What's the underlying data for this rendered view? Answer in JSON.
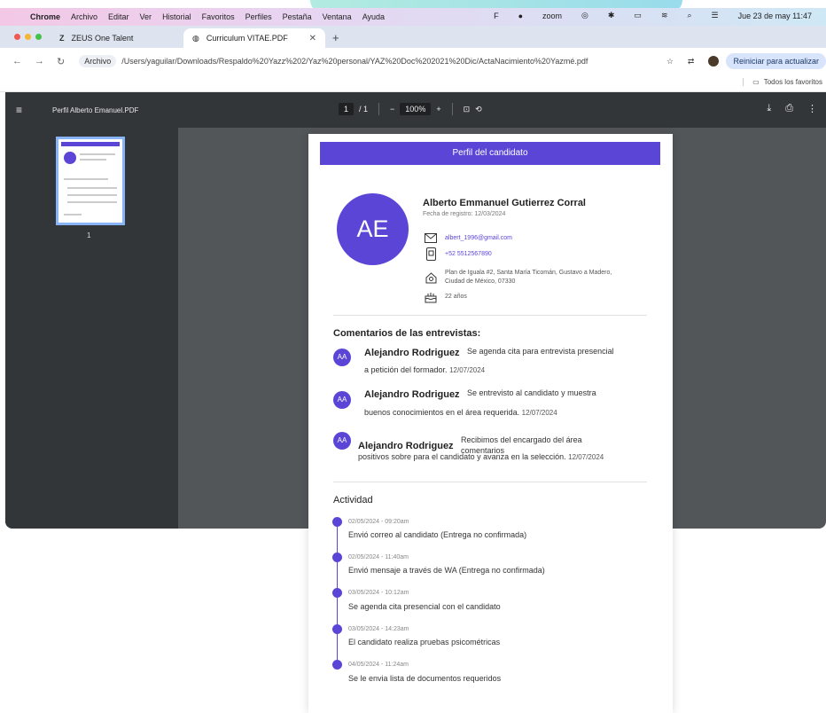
{
  "menubar": {
    "app": "Chrome",
    "items": [
      "Archivo",
      "Editar",
      "Ver",
      "Historial",
      "Favoritos",
      "Perfiles",
      "Pestaña",
      "Ventana",
      "Ayuda"
    ],
    "zoom_label": "zoom",
    "clock": "Jue 23 de may 11:47"
  },
  "tabs": [
    {
      "label": "ZEUS One Talent",
      "icon": "zeus-icon"
    },
    {
      "label": "Curriculum VITAE.PDF",
      "icon": "globe-icon"
    }
  ],
  "toolbar": {
    "archivo_chip": "Archivo",
    "url": "/Users/yaguilar/Downloads/Respaldo%20Yazz%202/Yaz%20personal/YAZ%20Doc%202021%20Dic/ActaNacimiento%20Yazmé.pdf",
    "update_button": "Reiniciar para actualizar",
    "bookmarks_folder": "Todos los favoritos"
  },
  "viewer": {
    "doc_title": "Perfil Alberto Emanuel.PDF",
    "page_current": "1",
    "page_total": "/ 1",
    "zoom": "100%",
    "thumb_number": "1"
  },
  "profile": {
    "header": "Perfil del candidato",
    "initials": "AE",
    "name": "Alberto Emmanuel Gutierrez Corral",
    "registered": "Fecha de registro: 12/03/2024",
    "email": "albert_1996@gmail.com",
    "phone": "+52 5512567890",
    "address_1": "Plan de Iguala #2, Santa María Ticomán, Gustavo a Madero,",
    "address_2": "Ciudad de México, 07330",
    "age": "22 años"
  },
  "comments": {
    "title": "Comentarios de las entrevistas:",
    "items": [
      {
        "initials": "AA",
        "author": "Alejandro Rodriguez",
        "line1": "Se agenda cita para entrevista presencial",
        "line2": "a petición del formador.",
        "date": "12/07/2024"
      },
      {
        "initials": "AA",
        "author": "Alejandro Rodriguez",
        "line1": "Se entrevisto al candidato y muestra",
        "line2": "buenos conocimientos en el área requerida.",
        "date": "12/07/2024"
      },
      {
        "initials": "AA",
        "author": "Alejandro Rodriguez",
        "line1": "Recibimos del encargado del área",
        "line1b": "comentarios",
        "line2": "positivos sobre para el candidato y avanza en la selección.",
        "date": "12/07/2024"
      }
    ]
  },
  "activity": {
    "title": "Actividad",
    "items": [
      {
        "date": "02/05/2024 - 09:20am",
        "text": "Envió correo al candidato (Entrega no confirmada)"
      },
      {
        "date": "02/05/2024 - 11:40am",
        "text": "Envió mensaje a través de WA (Entrega no confirmada)"
      },
      {
        "date": "03/05/2024 - 10:12am",
        "text": "Se agenda cita presencial con el candidato"
      },
      {
        "date": "03/05/2024 - 14:23am",
        "text": "El candidato realiza pruebas psicométricas"
      },
      {
        "date": "04/05/2024 - 11:24am",
        "text": "Se le envia lista de documentos requeridos"
      }
    ]
  },
  "colors": {
    "accent": "#5b45d6",
    "viewer_bg": "#525659",
    "toolbar_dark": "#323639"
  }
}
